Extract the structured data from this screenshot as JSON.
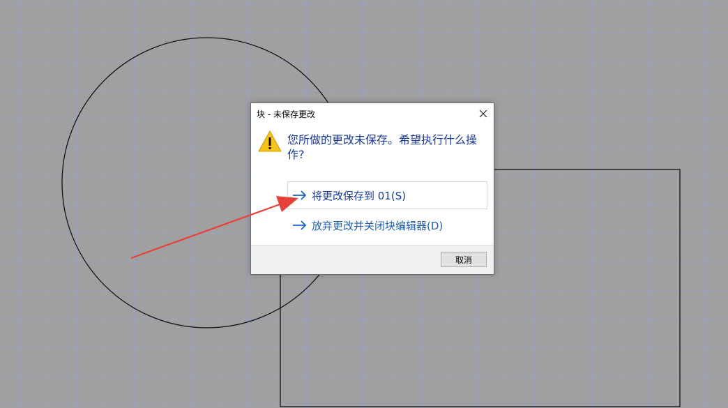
{
  "dialog": {
    "title": "块 - 未保存更改",
    "message": "您所做的更改未保存。希望执行什么操作?",
    "save_option": "将更改保存到 01(S)",
    "discard_option": "放弃更改并关闭块编辑器(D)",
    "cancel_label": "取消"
  },
  "icons": {
    "warning": "warning-triangle-icon",
    "close": "close-icon",
    "arrow": "arrow-right-icon"
  },
  "colors": {
    "canvas_background": "#a0a0a0",
    "grid_line": "#9aa3c4",
    "link_text": "#1a3a9b",
    "annotation_arrow": "#e8403a",
    "warning_fill": "#f7c21b"
  }
}
